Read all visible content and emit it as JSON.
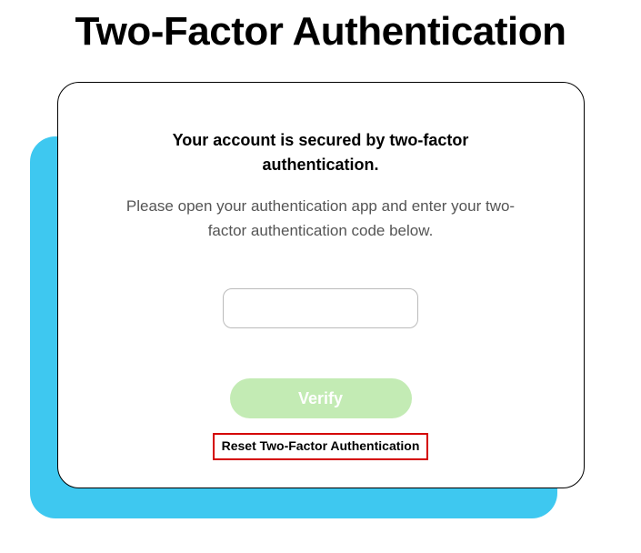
{
  "page": {
    "title": "Two-Factor Authentication"
  },
  "card": {
    "secured_text": "Your account is secured by two-factor authentication.",
    "instruction_text": "Please open your authentication app and enter your two-factor authentication code below.",
    "code_value": "",
    "verify_label": "Verify",
    "reset_label": "Reset Two-Factor Authentication"
  }
}
